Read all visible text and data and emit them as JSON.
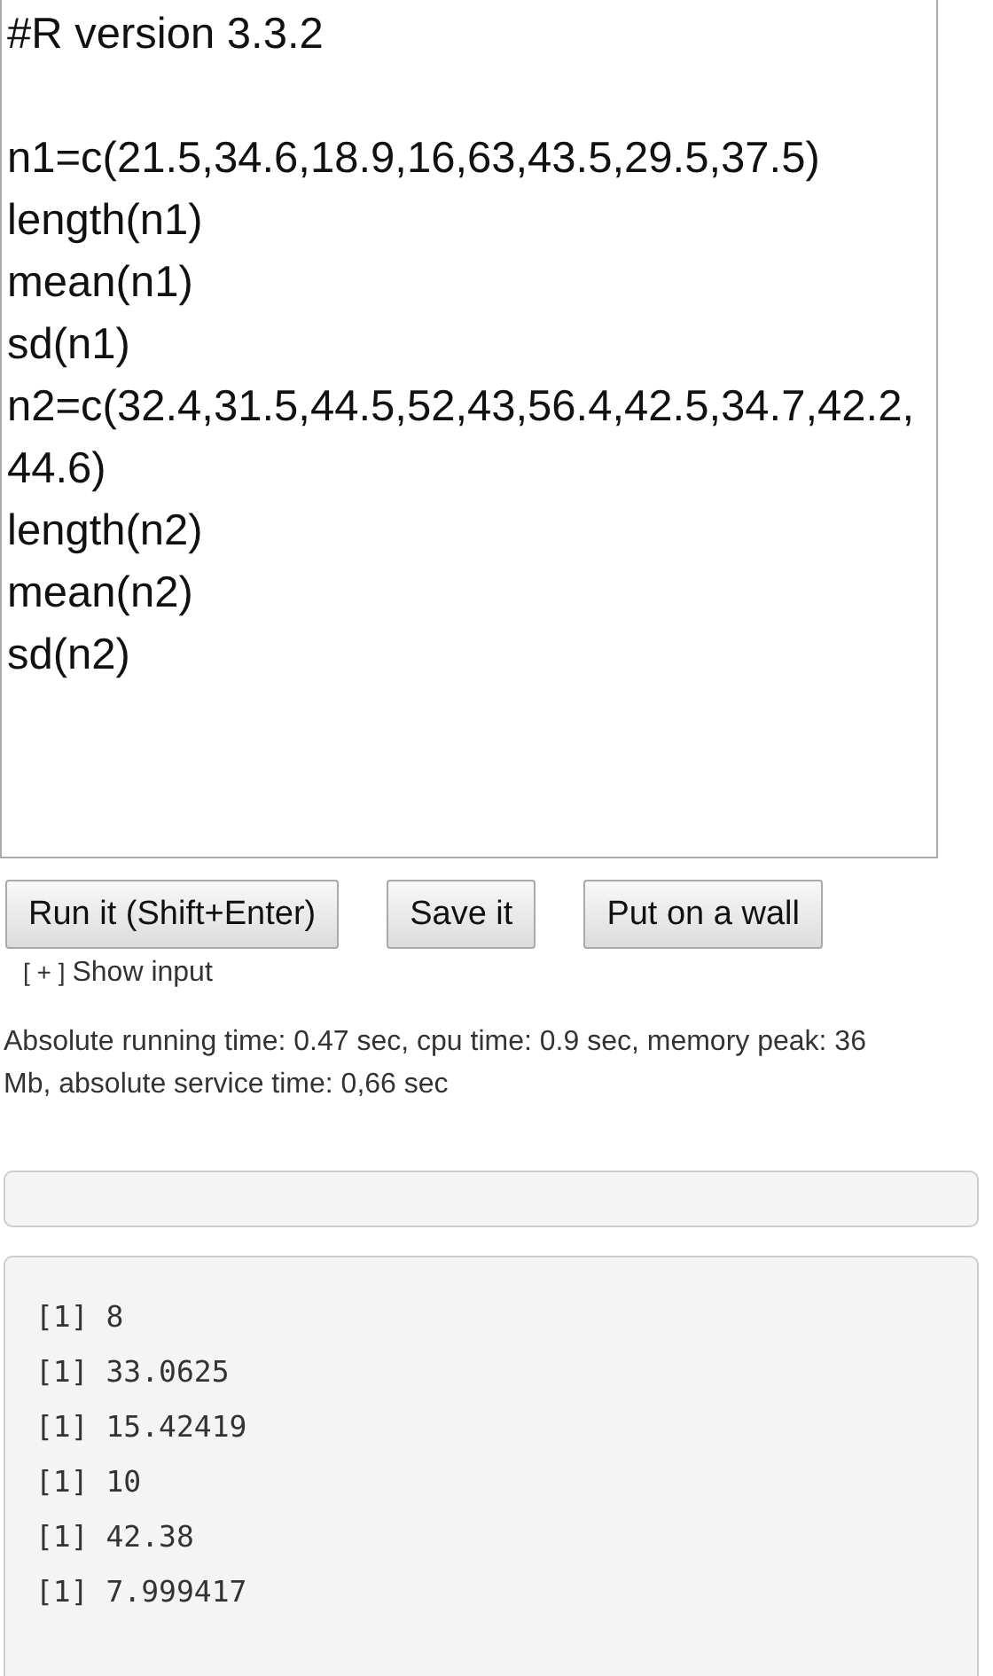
{
  "editor": {
    "blocks": [
      [
        "#R version 3.3.2"
      ],
      [
        "n1=c(21.5,34.6,18.9,16,63,43.5,29.5,37.5)",
        "length(n1)",
        "mean(n1)",
        "sd(n1)",
        "n2=c(32.4,31.5,44.5,52,43,56.4,42.5,34.7,42.2,44.6)",
        "length(n2)",
        "mean(n2)",
        "sd(n2)"
      ]
    ]
  },
  "buttons": [
    "Run it (Shift+Enter)",
    "Save it",
    "Put on a wall"
  ],
  "show_input": {
    "toggle": "[ + ]",
    "label": "Show input"
  },
  "stats": "Absolute running time: 0.47 sec, cpu time: 0.9 sec, memory peak: 36 Mb, absolute service time: 0,66 sec",
  "output_lines": [
    "[1] 8",
    "[1] 33.0625",
    "[1] 15.42419",
    "[1] 10",
    "[1] 42.38",
    "[1] 7.999417"
  ]
}
